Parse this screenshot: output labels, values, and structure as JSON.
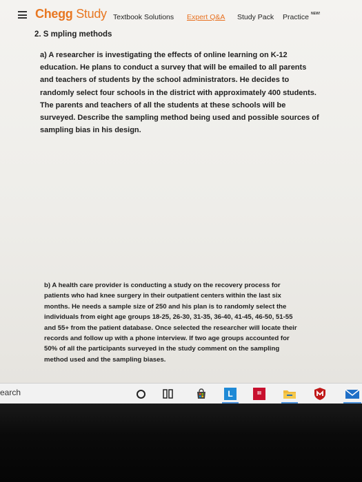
{
  "header": {
    "brand_chegg": "Chegg",
    "brand_study": "Study",
    "nav": [
      {
        "label": "Textbook Solutions"
      },
      {
        "label": "Expert Q&A"
      },
      {
        "label": "Study Pack"
      },
      {
        "label": "Practice"
      }
    ],
    "practice_badge": "NEW!"
  },
  "question": {
    "title": "2. S  mpling methods",
    "part_a": "a) A researcher is investigating the effects of online learning on K-12 education. He plans to conduct a survey that will be emailed to all parents and teachers of students by the school administrators. He decides to randomly select four schools in the district with approximately 400 students. The parents and teachers of all the students at these schools will be surveyed. Describe the sampling method being used and possible sources of sampling bias in his design.",
    "part_b": "b) A health care provider is conducting a study on the recovery process for patients who had knee surgery in their outpatient centers within the last six months. He needs a sample size of 250 and his plan is to randomly select the individuals from eight age groups 18-25, 26-30, 31-35, 36-40, 41-45, 46-50, 51-55 and 55+ from the patient database. Once selected the researcher will locate their records and follow up with a phone interview. If two age groups accounted for 50% of all the participants surveyed in the study comment on the sampling method used and the sampling biases."
  },
  "taskbar": {
    "search_text": "earch",
    "icons": [
      "cortana-icon",
      "task-view-icon",
      "store-icon",
      "l-app-icon",
      "red-app-icon",
      "file-explorer-icon",
      "mcafee-icon",
      "mail-icon"
    ],
    "l_app_letter": "L",
    "red_app_text": "III"
  },
  "colors": {
    "brand_orange": "#e87722",
    "taskbar_bg": "#f2f2f2",
    "bezel": "#0a0a0a"
  }
}
